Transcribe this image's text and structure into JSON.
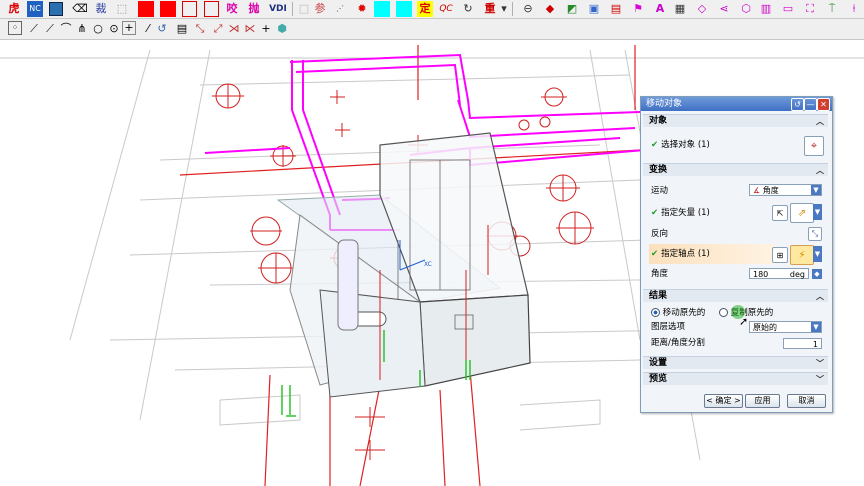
{
  "toolbar_row1": {
    "label_hu": "虎",
    "label_nc": "NC",
    "label_cai": "裁",
    "label_yao": "咬",
    "label_pao": "抛",
    "label_vdi": "VDI",
    "label_ding": "定",
    "label_qc": "QC",
    "label_zhong": "重",
    "label_a": "A",
    "accent_red": "#ff0000",
    "accent_cyan": "#00ffff"
  },
  "toolbar_row2": {
    "icons": [
      "snap-grid-icon",
      "line-icon",
      "curve-icon",
      "arc-icon",
      "circle-icon",
      "point-icon",
      "plus-icon",
      "rotate-icon",
      "cube-icon"
    ]
  },
  "dialog": {
    "title": "移动对象",
    "sections": {
      "object": "对象",
      "transform": "变换",
      "result": "结果",
      "settings": "设置",
      "preview": "预览"
    },
    "select_object": "选择对象 (1)",
    "motion_label": "运动",
    "motion_value": "角度",
    "specify_vector": "指定矢量 (1)",
    "reverse_label": "反向",
    "specify_pivot": "指定轴点 (1)",
    "angle_label": "角度",
    "angle_value": "180",
    "angle_unit": "deg",
    "move_original": "移动原先的",
    "copy_original": "复制原先的",
    "layer_option_label": "图层选项",
    "layer_option_value": "原始的",
    "distance_split_label": "距离/角度分割",
    "distance_split_value": "1",
    "ok_button": "< 确定 >",
    "apply_button": "应用",
    "cancel_button": "取消"
  },
  "viewport": {
    "axis_label_x": "XC"
  }
}
